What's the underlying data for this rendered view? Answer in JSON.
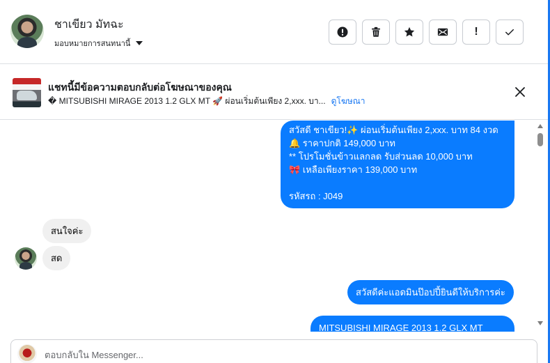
{
  "header": {
    "contact_name": "ชาเขียว มัทฉะ",
    "assign_label": "มอบหมายการสนทนานี้",
    "actions": [
      {
        "icon": "alert-circle-icon"
      },
      {
        "icon": "trash-icon"
      },
      {
        "icon": "star-icon"
      },
      {
        "icon": "mail-icon"
      },
      {
        "icon": "exclamation-icon",
        "glyph": "!"
      },
      {
        "icon": "checkmark-icon"
      }
    ]
  },
  "ad": {
    "title": "แชทนี้มีข้อความตอบกลับต่อโฆษณาของคุณ",
    "subtitle": "� MITSUBISHI MIRAGE 2013 1.2 GLX MT 🚀 ผ่อนเริ่มต้นเพียง 2,xxx. บา...",
    "link": "ดูโฆษณา"
  },
  "messages": {
    "outgoing_1": [
      "สวัสดี ชาเขียว!✨  ผ่อนเริ่มต้นเพียง 2,xxx. บาท 84 งวด",
      "🔔 ราคาปกติ 149,000 บาท",
      "** โปรโมชั่นข้าวแลกลด รับส่วนลด 10,000 บาท",
      "🎀  เหลือเพียงราคา 139,000 บาท",
      "",
      "รหัสรถ : J049"
    ],
    "incoming_1": "สนใจค่ะ",
    "incoming_2": "สด",
    "outgoing_2": "สวัสดีค่ะแอดมินป๊อปปี้ยินดีให้บริการค่ะ",
    "outgoing_3": "MITSUBISHI MIRAGE 2013 1.2 GLX MT"
  },
  "composer": {
    "placeholder": "ตอบกลับใน Messenger..."
  },
  "colors": {
    "accent": "#0a7cff",
    "incoming_bubble": "#f0f0f0",
    "link": "#1877f2"
  }
}
